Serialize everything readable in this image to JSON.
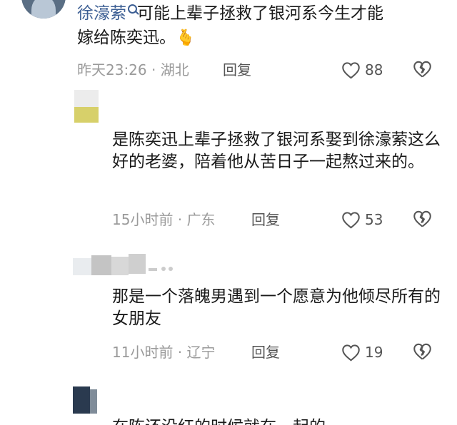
{
  "comments": [
    {
      "username": "徐濠萦",
      "text_line1": "可能上辈子拯救了银河系今生才能",
      "text_line2": "嫁给陈奕迅。",
      "emoji": "🫰",
      "time": "昨天23:26",
      "location": "湖北",
      "reply_label": "回复",
      "likes": "88"
    },
    {
      "text": "是陈奕迅上辈子拯救了银河系娶到徐濠萦这么好的老婆，陪着他从苦日子一起熬过来的。",
      "time": "15小时前",
      "location": "广东",
      "reply_label": "回复",
      "likes": "53"
    },
    {
      "text": "那是一个落魄男遇到一个愿意为他倾尽所有的女朋友",
      "time": "11小时前",
      "location": "辽宁",
      "reply_label": "回复",
      "likes": "19"
    },
    {
      "text_partial": "在陈还没红的时候就在一起的"
    }
  ]
}
